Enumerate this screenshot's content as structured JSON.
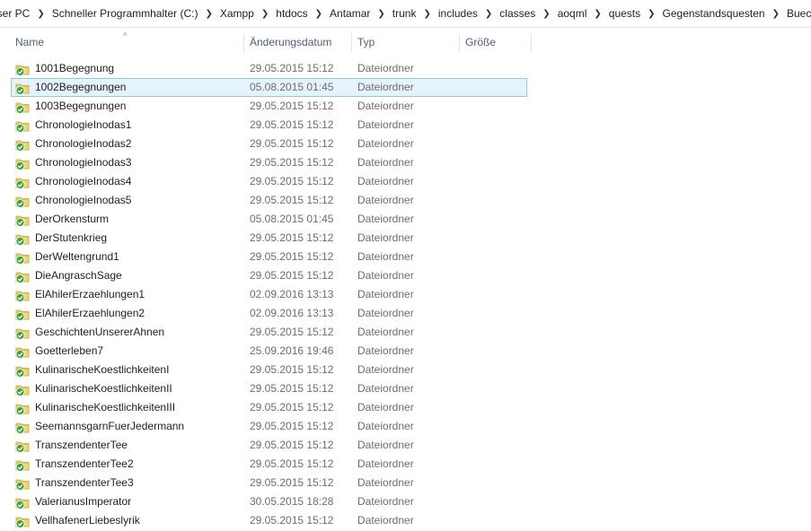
{
  "breadcrumb": [
    "eser PC",
    "Schneller Programmhalter (C:)",
    "Xampp",
    "htdocs",
    "Antamar",
    "trunk",
    "includes",
    "classes",
    "aoqml",
    "quests",
    "Gegenstandsquesten",
    "Buecher"
  ],
  "columns": {
    "name": "Name",
    "date": "Änderungsdatum",
    "type": "Typ",
    "size": "Größe"
  },
  "colors": {
    "selected_bg": "#e5f3fb",
    "selected_border": "#8dc7ea",
    "header_text": "#4c607a",
    "folder": "#f4d66b",
    "check": "#3aa33a"
  },
  "files": [
    {
      "name": "1001Begegnung",
      "date": "29.05.2015 15:12",
      "type": "Dateiordner",
      "selected": false
    },
    {
      "name": "1002Begegnungen",
      "date": "05.08.2015 01:45",
      "type": "Dateiordner",
      "selected": true
    },
    {
      "name": "1003Begegnungen",
      "date": "29.05.2015 15:12",
      "type": "Dateiordner",
      "selected": false
    },
    {
      "name": "ChronologieInodas1",
      "date": "29.05.2015 15:12",
      "type": "Dateiordner",
      "selected": false
    },
    {
      "name": "ChronologieInodas2",
      "date": "29.05.2015 15:12",
      "type": "Dateiordner",
      "selected": false
    },
    {
      "name": "ChronologieInodas3",
      "date": "29.05.2015 15:12",
      "type": "Dateiordner",
      "selected": false
    },
    {
      "name": "ChronologieInodas4",
      "date": "29.05.2015 15:12",
      "type": "Dateiordner",
      "selected": false
    },
    {
      "name": "ChronologieInodas5",
      "date": "29.05.2015 15:12",
      "type": "Dateiordner",
      "selected": false
    },
    {
      "name": "DerOrkensturm",
      "date": "05.08.2015 01:45",
      "type": "Dateiordner",
      "selected": false
    },
    {
      "name": "DerStutenkrieg",
      "date": "29.05.2015 15:12",
      "type": "Dateiordner",
      "selected": false
    },
    {
      "name": "DerWeltengrund1",
      "date": "29.05.2015 15:12",
      "type": "Dateiordner",
      "selected": false
    },
    {
      "name": "DieAngraschSage",
      "date": "29.05.2015 15:12",
      "type": "Dateiordner",
      "selected": false
    },
    {
      "name": "ElAhilerErzaehlungen1",
      "date": "02.09.2016 13:13",
      "type": "Dateiordner",
      "selected": false
    },
    {
      "name": "ElAhilerErzaehlungen2",
      "date": "02.09.2016 13:13",
      "type": "Dateiordner",
      "selected": false
    },
    {
      "name": "GeschichtenUnsererAhnen",
      "date": "29.05.2015 15:12",
      "type": "Dateiordner",
      "selected": false
    },
    {
      "name": "Goetterleben7",
      "date": "25.09.2016 19:46",
      "type": "Dateiordner",
      "selected": false
    },
    {
      "name": "KulinarischeKoestlichkeitenI",
      "date": "29.05.2015 15:12",
      "type": "Dateiordner",
      "selected": false
    },
    {
      "name": "KulinarischeKoestlichkeitenII",
      "date": "29.05.2015 15:12",
      "type": "Dateiordner",
      "selected": false
    },
    {
      "name": "KulinarischeKoestlichkeitenIII",
      "date": "29.05.2015 15:12",
      "type": "Dateiordner",
      "selected": false
    },
    {
      "name": "SeemannsgarnFuerJedermann",
      "date": "29.05.2015 15:12",
      "type": "Dateiordner",
      "selected": false
    },
    {
      "name": "TranszendenterTee",
      "date": "29.05.2015 15:12",
      "type": "Dateiordner",
      "selected": false
    },
    {
      "name": "TranszendenterTee2",
      "date": "29.05.2015 15:12",
      "type": "Dateiordner",
      "selected": false
    },
    {
      "name": "TranszendenterTee3",
      "date": "29.05.2015 15:12",
      "type": "Dateiordner",
      "selected": false
    },
    {
      "name": "ValerianusImperator",
      "date": "30.05.2015 18:28",
      "type": "Dateiordner",
      "selected": false
    },
    {
      "name": "VellhafenerLiebeslyrik",
      "date": "29.05.2015 15:12",
      "type": "Dateiordner",
      "selected": false
    }
  ]
}
